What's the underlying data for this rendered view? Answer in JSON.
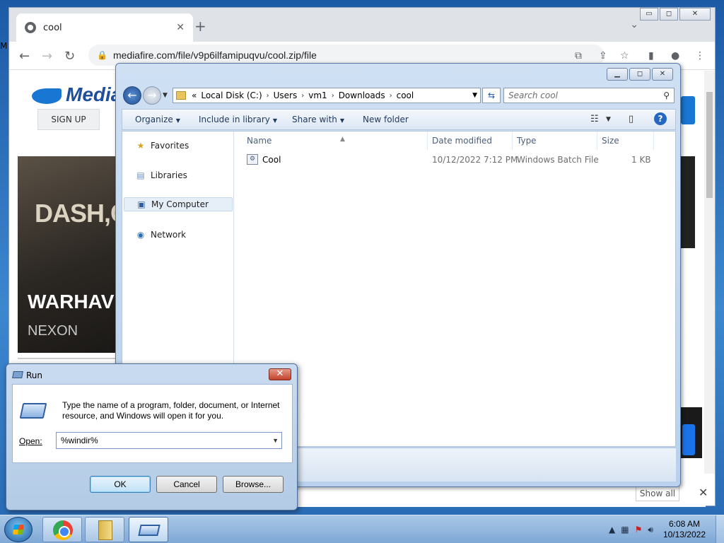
{
  "desktop": {
    "edge_label": "M"
  },
  "chrome": {
    "tab_title": "cool",
    "tab_close": "✕",
    "new_tab": "+",
    "url": "mediafire.com/file/v9p6ilfamipuqvu/cool.zip/file",
    "caption": {
      "minimize": "▭",
      "maximize": "◻",
      "close": "✕"
    }
  },
  "mediafire": {
    "logo_text": "Media",
    "signup": "SIGN UP",
    "ad": {
      "headline": "DASH,C",
      "title": "WARHAV",
      "subtitle": "NEXON"
    },
    "show_all": "Show all",
    "download_bar_close": "✕"
  },
  "explorer": {
    "breadcrumbs": [
      "Local Disk (C:)",
      "Users",
      "vm1",
      "Downloads",
      "cool"
    ],
    "breadcrumb_overflow": "«",
    "search_placeholder": "Search cool",
    "commands": {
      "organize": "Organize",
      "include_in_library": "Include in library",
      "share_with": "Share with",
      "new_folder": "New folder"
    },
    "nav": [
      {
        "label": "Favorites",
        "icon": "star-icon"
      },
      {
        "label": "Libraries",
        "icon": "libraries-icon"
      },
      {
        "label": "My Computer",
        "icon": "computer-icon",
        "selected": true
      },
      {
        "label": "Network",
        "icon": "network-icon"
      }
    ],
    "columns": [
      "Name",
      "Date modified",
      "Type",
      "Size"
    ],
    "files": [
      {
        "name": "Cool",
        "date_modified": "10/12/2022 7:12 PM",
        "type": "Windows Batch File",
        "size": "1 KB",
        "icon": "batch-file-icon"
      }
    ]
  },
  "run_dialog": {
    "title": "Run",
    "description": "Type the name of a program, folder, document, or Internet resource, and Windows will open it for you.",
    "open_label": "Open:",
    "open_value": "%windir%",
    "buttons": {
      "ok": "OK",
      "cancel": "Cancel",
      "browse": "Browse..."
    }
  },
  "taskbar": {
    "clock_time": "6:08 AM",
    "clock_date": "10/13/2022",
    "pinned": [
      "chrome-icon",
      "explorer-folder-icon",
      "run-icon"
    ]
  }
}
